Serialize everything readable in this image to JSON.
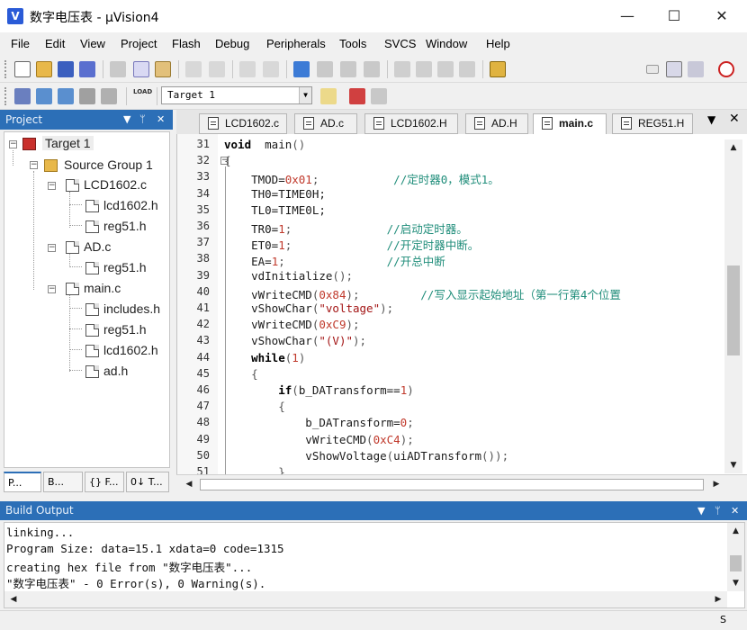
{
  "window": {
    "title": "数字电压表 - µVision4",
    "icon_letter": "V",
    "minimize": "—",
    "maximize": "☐",
    "close": "✕"
  },
  "menu": [
    "File",
    "Edit",
    "View",
    "Project",
    "Flash",
    "Debug",
    "Peripherals",
    "Tools",
    "SVCS",
    "Window",
    "Help"
  ],
  "menu_underline": [
    "F",
    "E",
    "V",
    "P",
    "a",
    "D",
    "P",
    "T",
    "S",
    "W",
    "H"
  ],
  "toolbar": {
    "target": "Target 1",
    "load_label": "LOAD",
    "icons": [
      "new-file-icon",
      "open-folder-icon",
      "save-icon",
      "save-all-icon",
      "cut-icon",
      "copy-icon",
      "paste-icon",
      "undo-icon",
      "redo-icon",
      "nav-back-icon",
      "nav-forward-icon",
      "bookmark-icon",
      "bookmark-prev-icon",
      "bookmark-next-icon",
      "bookmark-clear-icon",
      "indent-icon",
      "unindent-icon",
      "comment-icon",
      "uncomment-icon",
      "find-in-files-icon",
      "debug-start-icon",
      "settings-icon",
      "config-icon"
    ]
  },
  "project_panel": {
    "title": "Project",
    "tree": [
      {
        "label": "Target 1",
        "level": 0
      },
      {
        "label": "Source Group 1",
        "level": 1
      },
      {
        "label": "LCD1602.c",
        "level": 2
      },
      {
        "label": "lcd1602.h",
        "level": 3
      },
      {
        "label": "reg51.h",
        "level": 3
      },
      {
        "label": "AD.c",
        "level": 2
      },
      {
        "label": "reg51.h",
        "level": 3
      },
      {
        "label": "main.c",
        "level": 2
      },
      {
        "label": "includes.h",
        "level": 3
      },
      {
        "label": "reg51.h",
        "level": 3
      },
      {
        "label": "lcd1602.h",
        "level": 3
      },
      {
        "label": "ad.h",
        "level": 3
      }
    ],
    "tabs": [
      "P...",
      "B...",
      "{} F...",
      "0↓ T..."
    ]
  },
  "editor": {
    "tabs": [
      "LCD1602.c",
      "AD.c",
      "LCD1602.H",
      "AD.H",
      "main.c",
      "REG51.H"
    ],
    "active_tab": "main.c",
    "lines": [
      {
        "n": "31",
        "code": [
          [
            "kw",
            "void"
          ],
          [
            "",
            "  main"
          ],
          [
            "op",
            "()"
          ]
        ]
      },
      {
        "n": "32",
        "code": [
          [
            "op",
            "{"
          ]
        ]
      },
      {
        "n": "33",
        "code": [
          [
            "",
            "    TMOD="
          ],
          [
            "num",
            "0x01"
          ],
          [
            "op",
            ";"
          ],
          [
            "",
            "           "
          ],
          [
            "cmt",
            "//定时器0，模式1。"
          ]
        ]
      },
      {
        "n": "34",
        "code": [
          [
            "",
            "    TH0=TIME0H;"
          ]
        ]
      },
      {
        "n": "35",
        "code": [
          [
            "",
            "    TL0=TIME0L;"
          ]
        ]
      },
      {
        "n": "36",
        "code": [
          [
            "",
            "    TR0="
          ],
          [
            "num",
            "1"
          ],
          [
            "op",
            ";"
          ],
          [
            "",
            "              "
          ],
          [
            "cmt",
            "//启动定时器。"
          ]
        ]
      },
      {
        "n": "37",
        "code": [
          [
            "",
            "    ET0="
          ],
          [
            "num",
            "1"
          ],
          [
            "op",
            ";"
          ],
          [
            "",
            "              "
          ],
          [
            "cmt",
            "//开定时器中断。"
          ]
        ]
      },
      {
        "n": "38",
        "code": [
          [
            "",
            "    EA="
          ],
          [
            "num",
            "1"
          ],
          [
            "op",
            ";"
          ],
          [
            "",
            "               "
          ],
          [
            "cmt",
            "//开总中断"
          ]
        ]
      },
      {
        "n": "39",
        "code": [
          [
            "",
            "    vdInitialize"
          ],
          [
            "op",
            "();"
          ]
        ]
      },
      {
        "n": "40",
        "code": [
          [
            "",
            "    vWriteCMD"
          ],
          [
            "op",
            "("
          ],
          [
            "num",
            "0x84"
          ],
          [
            "op",
            ");"
          ],
          [
            "",
            "         "
          ],
          [
            "cmt",
            "//写入显示起始地址（第一行第4个位置"
          ]
        ]
      },
      {
        "n": "41",
        "code": [
          [
            "",
            "    vShowChar"
          ],
          [
            "op",
            "("
          ],
          [
            "str",
            "\"voltage\""
          ],
          [
            "op",
            ");"
          ]
        ]
      },
      {
        "n": "42",
        "code": [
          [
            "",
            "    vWriteCMD"
          ],
          [
            "op",
            "("
          ],
          [
            "num",
            "0xC9"
          ],
          [
            "op",
            ");"
          ]
        ]
      },
      {
        "n": "43",
        "code": [
          [
            "",
            "    vShowChar"
          ],
          [
            "op",
            "("
          ],
          [
            "str",
            "\"(V)\""
          ],
          [
            "op",
            ");"
          ]
        ]
      },
      {
        "n": "44",
        "code": [
          [
            "",
            "    "
          ],
          [
            "kw",
            "while"
          ],
          [
            "op",
            "("
          ],
          [
            "num",
            "1"
          ],
          [
            "op",
            ")"
          ]
        ]
      },
      {
        "n": "45",
        "code": [
          [
            "",
            "    "
          ],
          [
            "op",
            "{"
          ]
        ]
      },
      {
        "n": "46",
        "code": [
          [
            "",
            "        "
          ],
          [
            "kw",
            "if"
          ],
          [
            "op",
            "("
          ],
          [
            "",
            "b_DATransform=="
          ],
          [
            "num",
            "1"
          ],
          [
            "op",
            ")"
          ]
        ]
      },
      {
        "n": "47",
        "code": [
          [
            "",
            "        "
          ],
          [
            "op",
            "{"
          ]
        ]
      },
      {
        "n": "48",
        "code": [
          [
            "",
            "            b_DATransform="
          ],
          [
            "num",
            "0"
          ],
          [
            "op",
            ";"
          ]
        ]
      },
      {
        "n": "49",
        "code": [
          [
            "",
            "            vWriteCMD"
          ],
          [
            "op",
            "("
          ],
          [
            "num",
            "0xC4"
          ],
          [
            "op",
            ");"
          ]
        ]
      },
      {
        "n": "50",
        "code": [
          [
            "",
            "            vShowVoltage"
          ],
          [
            "op",
            "("
          ],
          [
            "",
            "uiADTransform"
          ],
          [
            "op",
            "());"
          ]
        ]
      },
      {
        "n": "51",
        "code": [
          [
            "",
            "        "
          ],
          [
            "op",
            "}"
          ]
        ]
      }
    ]
  },
  "build_output": {
    "title": "Build Output",
    "lines": [
      "linking...",
      "Program Size: data=15.1 xdata=0 code=1315",
      "creating hex file from \"数字电压表\"...",
      "\"数字电压表\" - 0 Error(s), 0 Warning(s)."
    ]
  },
  "status": {
    "caps": "S"
  },
  "colors": {
    "panel_header": "#2c6fb7",
    "comment": "#1f8d7a",
    "number": "#c0392b"
  }
}
